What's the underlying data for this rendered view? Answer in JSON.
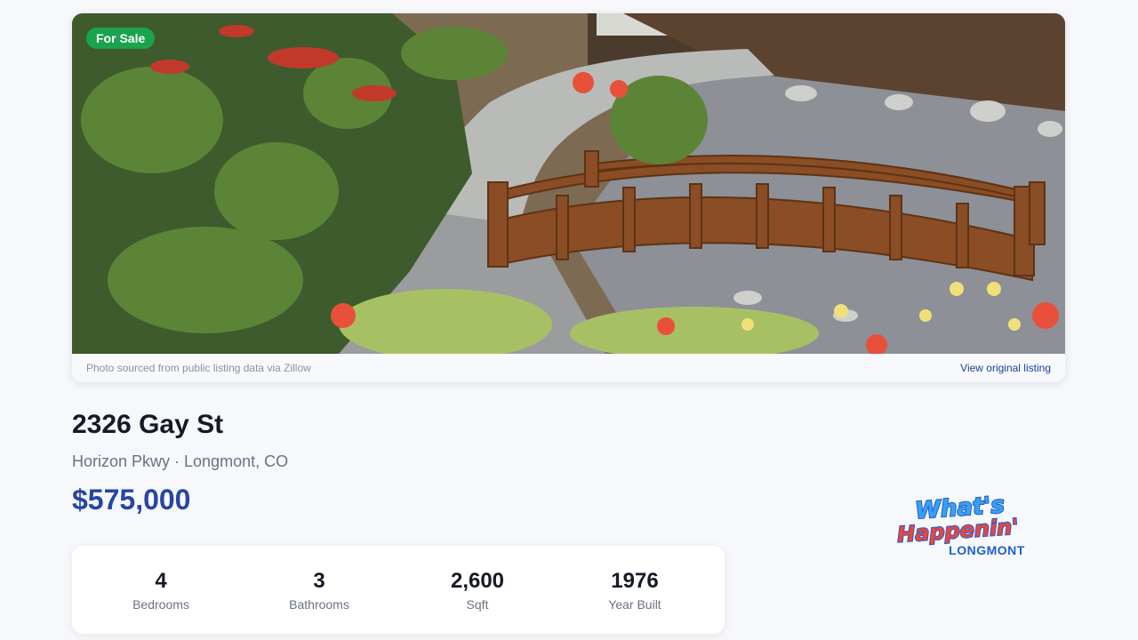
{
  "listing": {
    "status": "For Sale",
    "photo_credit": "Photo sourced from public listing data via Zillow",
    "view_link": "View original listing",
    "address": "2326 Gay St",
    "subaddress": "Horizon Pkwy · Longmont, CO",
    "price": "$575,000"
  },
  "stats": [
    {
      "value": "4",
      "label": "Bedrooms"
    },
    {
      "value": "3",
      "label": "Bathrooms"
    },
    {
      "value": "2,600",
      "label": "Sqft"
    },
    {
      "value": "1976",
      "label": "Year Built"
    }
  ],
  "brand": {
    "logo_line1": "What's",
    "logo_line2": "Happenin'",
    "logo_line3": "LONGMONT"
  },
  "colors": {
    "badge": "#1aa34f",
    "price": "#2745a4",
    "logo_blue": "#1f5fd1",
    "logo_red": "#e8453c"
  }
}
